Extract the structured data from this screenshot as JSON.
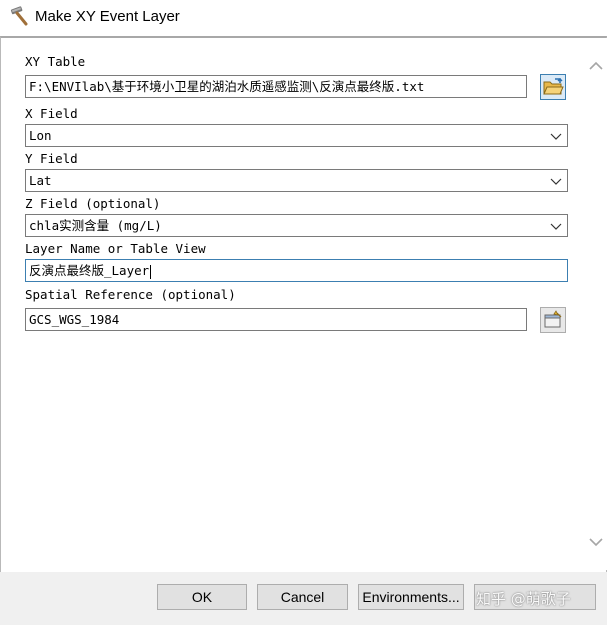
{
  "window": {
    "title": "Make XY Event Layer",
    "icon": "hammer-icon"
  },
  "form": {
    "xy_table": {
      "label": "XY Table",
      "value": "F:\\ENVIlab\\基于环境小卫星的湖泊水质遥感监测\\反演点最终版.txt",
      "browse_icon": "open-folder-icon"
    },
    "x_field": {
      "label": "X Field",
      "value": "Lon"
    },
    "y_field": {
      "label": "Y Field",
      "value": "Lat"
    },
    "z_field": {
      "label": "Z Field (optional)",
      "value": "chla实测含量 (mg/L)"
    },
    "layer_name": {
      "label": "Layer Name or Table View",
      "value": "反演点最终版_Layer"
    },
    "spatial_reference": {
      "label": "Spatial Reference (optional)",
      "value": "GCS_WGS_1984",
      "properties_icon": "spatial-reference-properties-icon"
    }
  },
  "buttons": {
    "ok": "OK",
    "cancel": "Cancel",
    "environments": "Environments..."
  },
  "watermark": "知乎 @萌歌子"
}
